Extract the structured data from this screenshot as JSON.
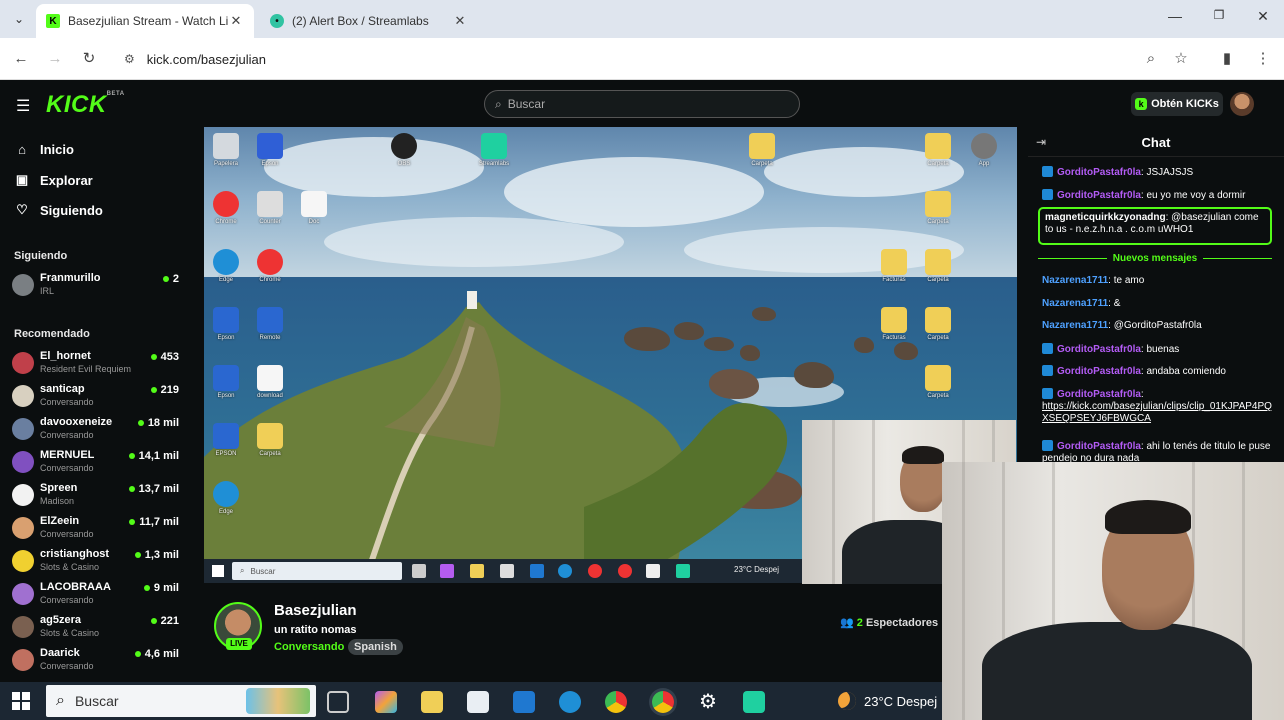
{
  "browser": {
    "tabs": [
      {
        "title": "Basezjulian Stream - Watch Live",
        "active": true
      },
      {
        "title": "(2) Alert Box / Streamlabs",
        "active": false
      }
    ],
    "url": "kick.com/basezjulian"
  },
  "kick": {
    "search_placeholder": "Buscar",
    "get_kicks": "Obtén KICKs",
    "logo": "KICK",
    "logo_beta": "BETA"
  },
  "sidebar": {
    "nav": [
      {
        "label": "Inicio",
        "icon": "home-icon"
      },
      {
        "label": "Explorar",
        "icon": "compass-icon"
      },
      {
        "label": "Siguiendo",
        "icon": "heart-icon"
      }
    ],
    "following_title": "Siguiendo",
    "following": [
      {
        "name": "Franmurillo",
        "category": "IRL",
        "viewers": "2"
      }
    ],
    "recommended_title": "Recomendado",
    "recommended": [
      {
        "name": "El_hornet",
        "category": "Resident Evil Requiem",
        "viewers": "453"
      },
      {
        "name": "santicap",
        "category": "Conversando",
        "viewers": "219"
      },
      {
        "name": "davooxeneize",
        "category": "Conversando",
        "viewers": "18 mil"
      },
      {
        "name": "MERNUEL",
        "category": "Conversando",
        "viewers": "14,1 mil"
      },
      {
        "name": "Spreen",
        "category": "Madison",
        "viewers": "13,7 mil"
      },
      {
        "name": "ElZeein",
        "category": "Conversando",
        "viewers": "11,7 mil"
      },
      {
        "name": "cristianghost",
        "category": "Slots & Casino",
        "viewers": "1,3 mil"
      },
      {
        "name": "LACOBRAAA",
        "category": "Conversando",
        "viewers": "9 mil"
      },
      {
        "name": "ag5zera",
        "category": "Slots & Casino",
        "viewers": "221"
      },
      {
        "name": "Daarick",
        "category": "Conversando",
        "viewers": "4,6 mil"
      }
    ]
  },
  "stream": {
    "streamer": "Basezjulian",
    "title": "un ratito nomas",
    "category": "Conversando",
    "language": "Spanish",
    "live": "LIVE",
    "viewers_count": "2",
    "viewers_label": "Espectadores",
    "inner_search": "Buscar",
    "inner_weather": "23°C  Despej"
  },
  "chat": {
    "title": "Chat",
    "new_messages": "Nuevos mensajes",
    "messages_before": [
      {
        "user": "GorditoPastafr0la",
        "text": "JSJAJSJS",
        "badge": true
      },
      {
        "user": "GorditoPastafr0la",
        "text": "eu yo me voy a dormir",
        "badge": true
      }
    ],
    "highlighted": {
      "user": "magneticquirkkzyonadng",
      "text": "@basezjulian come to us - n.e.z.h.n.a . c.o.m uWHO1"
    },
    "messages_after": [
      {
        "user": "Nazarena1711",
        "text": "te amo",
        "badge": false
      },
      {
        "user": "Nazarena1711",
        "text": "&",
        "badge": false
      },
      {
        "user": "Nazarena1711",
        "text": "@GorditoPastafr0la",
        "badge": false
      },
      {
        "user": "GorditoPastafr0la",
        "text": "buenas",
        "badge": true
      },
      {
        "user": "GorditoPastafr0la",
        "text": "andaba comiendo",
        "badge": true
      },
      {
        "user": "GorditoPastafr0la",
        "text": "https://kick.com/basezjulian/clips/clip_01KJPAP4PQXSEQPSEYJ6FBWGCA",
        "badge": true
      },
      {
        "user": "GorditoPastafr0la",
        "text": "ahi lo tenés de titulo le puse pendejo no dura nada",
        "badge": true
      }
    ]
  },
  "taskbar": {
    "search": "Buscar",
    "weather": "23°C  Despej"
  },
  "colors": {
    "kick_green": "#53fc18",
    "background": "#0b0e0f",
    "chat_user_purple": "#b35cf5",
    "chat_user_blue": "#4ea1ff"
  }
}
